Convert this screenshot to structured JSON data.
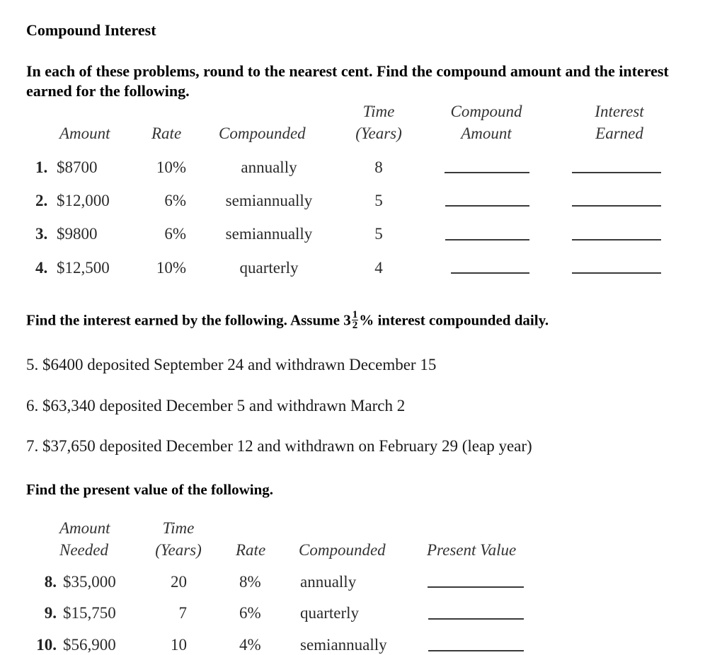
{
  "title": "Compound Interest",
  "section1": {
    "instructions": "In each of these problems, round to the nearest cent. Find the compound amount and the interest earned for the following.",
    "headers": {
      "amount": "Amount",
      "rate": "Rate",
      "compounded": "Compounded",
      "time_line1": "Time",
      "time_line2": "(Years)",
      "compound_amount_line1": "Compound",
      "compound_amount_line2": "Amount",
      "interest_earned_line1": "Interest",
      "interest_earned_line2": "Earned"
    },
    "rows": [
      {
        "number": "1.",
        "amount": "$8700",
        "rate": "10%",
        "compounded": "annually",
        "time": "8",
        "compound_amount": "",
        "interest_earned": ""
      },
      {
        "number": "2.",
        "amount": "$12,000",
        "rate": "6%",
        "compounded": "semiannually",
        "time": "5",
        "compound_amount": "",
        "interest_earned": ""
      },
      {
        "number": "3.",
        "amount": "$9800",
        "rate": "6%",
        "compounded": "semiannually",
        "time": "5",
        "compound_amount": "",
        "interest_earned": ""
      },
      {
        "number": "4.",
        "amount": "$12,500",
        "rate": "10%",
        "compounded": "quarterly",
        "time": "4",
        "compound_amount": "",
        "interest_earned": ""
      }
    ]
  },
  "section2": {
    "heading_before": "Find the interest earned by the following. Assume 3",
    "fraction_numerator": "1",
    "fraction_denominator": "2",
    "heading_after": "% interest compounded daily.",
    "problems": [
      "5. $6400 deposited September 24 and withdrawn December 15",
      "6. $63,340 deposited December 5 and withdrawn March 2",
      "7. $37,650 deposited December 12 and withdrawn on February 29 (leap year)"
    ]
  },
  "section3": {
    "heading": "Find the present value of the following.",
    "headers": {
      "amount_line1": "Amount",
      "amount_line2": "Needed",
      "time_line1": "Time",
      "time_line2": "(Years)",
      "rate": "Rate",
      "compounded": "Compounded",
      "present_value": "Present Value"
    },
    "rows": [
      {
        "number": "8.",
        "amount": "$35,000",
        "time": "20",
        "rate": "8%",
        "compounded": "annually",
        "present_value": ""
      },
      {
        "number": "9.",
        "amount": "$15,750",
        "time": "7",
        "rate": "6%",
        "compounded": "quarterly",
        "present_value": ""
      },
      {
        "number": "10.",
        "amount": "$56,900",
        "time": "10",
        "rate": "4%",
        "compounded": "semiannually",
        "present_value": ""
      }
    ]
  }
}
